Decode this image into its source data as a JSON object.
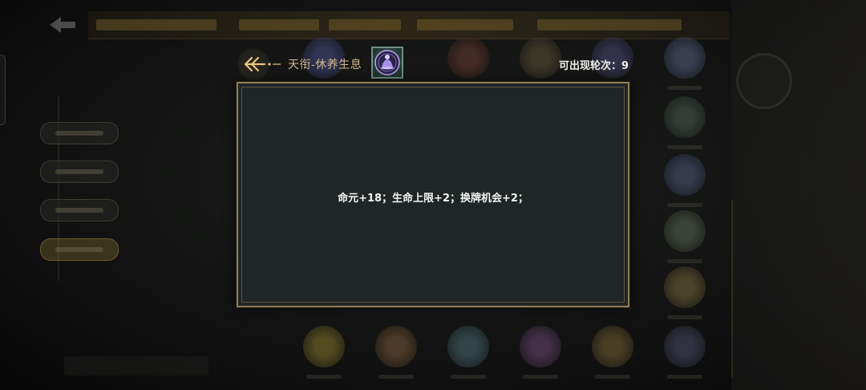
{
  "event": {
    "title": "天衔-休养生息",
    "rounds_label": "可出现轮次：",
    "rounds_value": "9",
    "effects": "命元+18；生命上限+2；换牌机会+2；"
  },
  "icons": {
    "back": "back-arrow-icon",
    "emblem": "meditating-figure-emblem-icon"
  },
  "colors": {
    "gold": "#d2b98b",
    "dialog_bg": "#202526",
    "dialog_border": "#8f7f55",
    "text": "#f4f4f2"
  }
}
